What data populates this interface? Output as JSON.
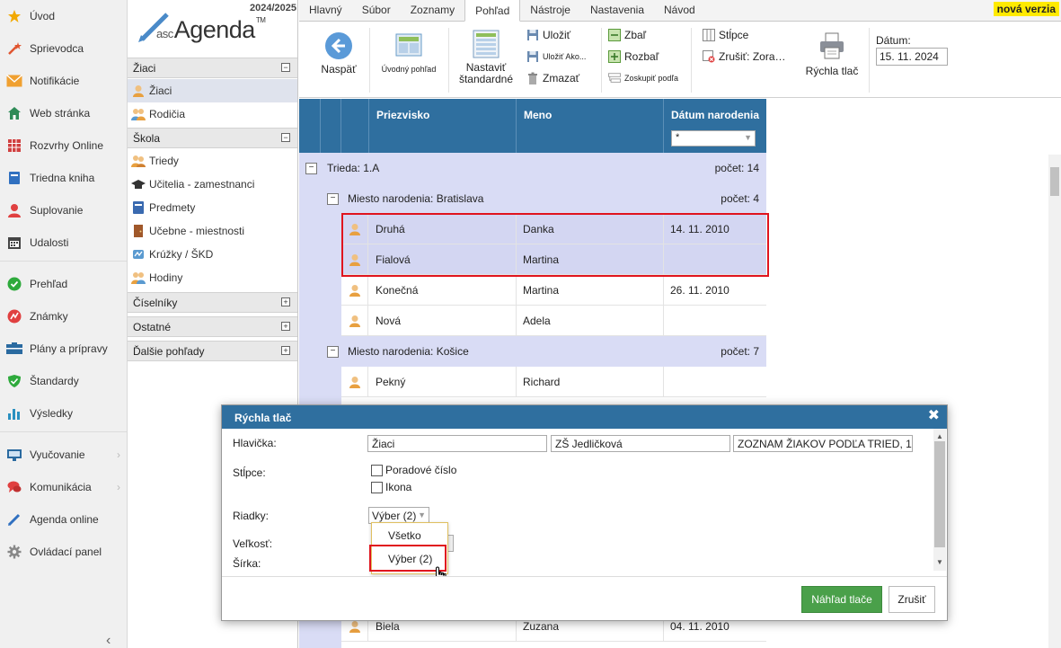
{
  "leftnav": {
    "items": [
      {
        "label": "Úvod",
        "icon": "star-icon",
        "color": "#f2a900"
      },
      {
        "label": "Sprievodca",
        "icon": "wand-icon",
        "color": "#e05530"
      },
      {
        "label": "Notifikácie",
        "icon": "envelope-icon",
        "color": "#f0a030"
      },
      {
        "label": "Web stránka",
        "icon": "home-icon",
        "color": "#2e8b57"
      },
      {
        "label": "Rozvrhy Online",
        "icon": "timetable-icon",
        "color": "#d04040"
      },
      {
        "label": "Triedna kniha",
        "icon": "book-icon",
        "color": "#3070c0"
      },
      {
        "label": "Suplovanie",
        "icon": "person-swap-icon",
        "color": "#e04040"
      },
      {
        "label": "Udalosti",
        "icon": "calendar-icon",
        "color": "#444444"
      },
      {
        "label": "Prehľad",
        "icon": "check-circle-icon",
        "color": "#2eaa3c"
      },
      {
        "label": "Známky",
        "icon": "grade-icon",
        "color": "#e04040"
      },
      {
        "label": "Plány a prípravy",
        "icon": "plan-icon",
        "color": "#2a6aa0"
      },
      {
        "label": "Štandardy",
        "icon": "shield-icon",
        "color": "#2eaa3c"
      },
      {
        "label": "Výsledky",
        "icon": "bar-chart-icon",
        "color": "#2a90c0"
      },
      {
        "label": "Vyučovanie",
        "icon": "teaching-icon",
        "color": "#2a6aa0"
      },
      {
        "label": "Komunikácia",
        "icon": "chat-icon",
        "color": "#e04040"
      },
      {
        "label": "Agenda online",
        "icon": "pen-icon",
        "color": "#3070c0"
      },
      {
        "label": "Ovládací panel",
        "icon": "gear-icon",
        "color": "#888888"
      }
    ]
  },
  "logo": {
    "year": "2024/2025",
    "asc": "asc",
    "name": "Agenda",
    "tm": "TM"
  },
  "subnav": {
    "sections": [
      {
        "label": "Žiaci",
        "toggle": "−"
      },
      {
        "label": "Škola",
        "toggle": "−"
      },
      {
        "label": "Číselníky",
        "toggle": "+"
      },
      {
        "label": "Ostatné",
        "toggle": "+"
      },
      {
        "label": "Ďalšie pohľady",
        "toggle": "+"
      }
    ],
    "items": [
      {
        "label": "Žiaci",
        "icon": "student-icon"
      },
      {
        "label": "Rodičia",
        "icon": "parents-icon"
      },
      {
        "label": "Triedy",
        "icon": "class-icon"
      },
      {
        "label": "Učitelia - zamestnanci",
        "icon": "graduation-cap-icon"
      },
      {
        "label": "Predmety",
        "icon": "subject-book-icon"
      },
      {
        "label": "Učebne - miestnosti",
        "icon": "door-icon"
      },
      {
        "label": "Krúžky / ŠKD",
        "icon": "club-icon"
      },
      {
        "label": "Hodiny",
        "icon": "hours-icon"
      }
    ]
  },
  "tabs": [
    "Hlavný",
    "Súbor",
    "Zoznamy",
    "Pohľad",
    "Nástroje",
    "Nastavenia",
    "Návod"
  ],
  "new_version": "nová verzia",
  "ribbon": {
    "back": "Naspäť",
    "home_view": "Úvodný pohľad",
    "set_default_1": "Nastaviť",
    "set_default_2": "štandardné",
    "save": "Uložiť",
    "save_as": "Uložiť Ako...",
    "delete": "Zmazať",
    "collapse": "Zbaľ",
    "expand": "Rozbaľ",
    "group_by": "Zoskupiť podľa",
    "columns": "Stĺpce",
    "cancel_sort": "Zrušiť: Zora…",
    "quick_print": "Rýchla tlač",
    "date_label": "Dátum:",
    "date_value": "15. 11. 2024"
  },
  "grid": {
    "headers": {
      "surname": "Priezvisko",
      "name": "Meno",
      "dob": "Dátum narodenia"
    },
    "dob_filter": "*",
    "group1": {
      "label": "Trieda: 1.A",
      "count": "počet: 14"
    },
    "group2": {
      "label": "Miesto narodenia: Bratislava",
      "count": "počet: 4"
    },
    "group3": {
      "label": "Miesto narodenia: Košice",
      "count": "počet: 7"
    },
    "rows": [
      {
        "surname": "Druhá",
        "name": "Danka",
        "dob": "14. 11. 2010"
      },
      {
        "surname": "Fialová",
        "name": "Martina",
        "dob": ""
      },
      {
        "surname": "Konečná",
        "name": "Martina",
        "dob": "26. 11. 2010"
      },
      {
        "surname": "Nová",
        "name": "Adela",
        "dob": ""
      },
      {
        "surname": "Pekný",
        "name": "Richard",
        "dob": ""
      },
      {
        "surname": "Biela",
        "name": "Zuzana",
        "dob": "04. 11. 2010"
      }
    ]
  },
  "dialog": {
    "title": "Rýchla tlač",
    "header_label": "Hlavička:",
    "header_values": [
      "Žiaci",
      "ZŠ Jedličková",
      "ZOZNAM ŽIAKOV PODĽA TRIED, 1"
    ],
    "columns_label": "Stĺpce:",
    "col_options": [
      "Poradové číslo",
      "Ikona"
    ],
    "rows_label": "Riadky:",
    "rows_value": "Výber (2)",
    "rows_options": [
      "Všetko",
      "Výber (2)"
    ],
    "size_label": "Veľkosť:",
    "width_label": "Šírka:",
    "preview_button": "Náhľad tlače",
    "cancel_button": "Zrušiť"
  }
}
